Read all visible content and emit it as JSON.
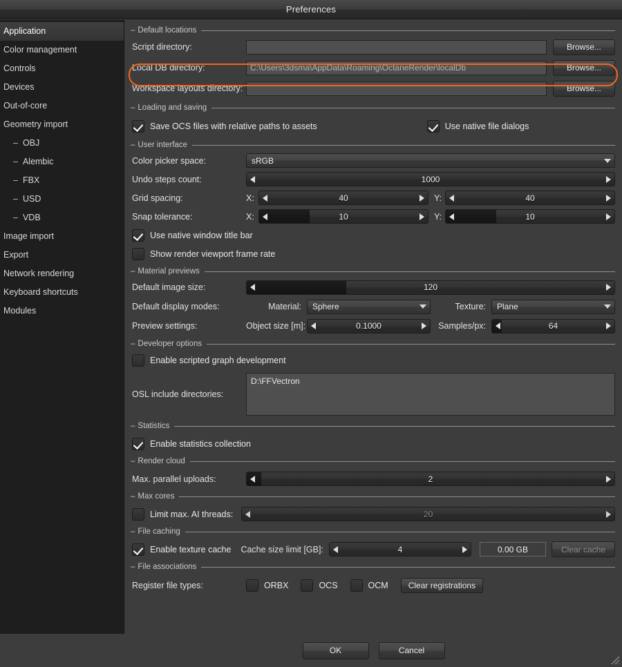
{
  "window": {
    "title": "Preferences"
  },
  "sidebar": {
    "items": [
      {
        "label": "Application",
        "selected": true,
        "sub": false
      },
      {
        "label": "Color management",
        "selected": false,
        "sub": false
      },
      {
        "label": "Controls",
        "selected": false,
        "sub": false
      },
      {
        "label": "Devices",
        "selected": false,
        "sub": false
      },
      {
        "label": "Out-of-core",
        "selected": false,
        "sub": false
      },
      {
        "label": "Geometry import",
        "selected": false,
        "sub": false
      },
      {
        "label": "OBJ",
        "selected": false,
        "sub": true
      },
      {
        "label": "Alembic",
        "selected": false,
        "sub": true
      },
      {
        "label": "FBX",
        "selected": false,
        "sub": true
      },
      {
        "label": "USD",
        "selected": false,
        "sub": true
      },
      {
        "label": "VDB",
        "selected": false,
        "sub": true
      },
      {
        "label": "Image import",
        "selected": false,
        "sub": false
      },
      {
        "label": "Export",
        "selected": false,
        "sub": false
      },
      {
        "label": "Network rendering",
        "selected": false,
        "sub": false
      },
      {
        "label": "Keyboard shortcuts",
        "selected": false,
        "sub": false
      },
      {
        "label": "Modules",
        "selected": false,
        "sub": false
      }
    ]
  },
  "groups": {
    "default_locations": "Default locations",
    "loading_and_saving": "Loading and saving",
    "user_interface": "User interface",
    "material_previews": "Material previews",
    "developer_options": "Developer options",
    "statistics": "Statistics",
    "render_cloud": "Render cloud",
    "max_cores": "Max cores",
    "file_caching": "File caching",
    "file_associations": "File associations"
  },
  "default_locations": {
    "script_dir_label": "Script directory:",
    "script_dir_value": "",
    "local_db_label": "Local DB directory:",
    "local_db_value": "C:\\Users\\3dsma\\AppData\\Roaming\\OctaneRender\\localDb",
    "workspace_label": "Workspace layouts directory:",
    "workspace_value": "",
    "browse_label": "Browse...",
    "highlight_color": "#f26722"
  },
  "loading_and_saving": {
    "save_ocs_label": "Save OCS files with relative paths to assets",
    "save_ocs_checked": true,
    "native_dialogs_label": "Use native file dialogs",
    "native_dialogs_checked": true
  },
  "user_interface": {
    "color_picker_label": "Color picker space:",
    "color_picker_value": "sRGB",
    "undo_label": "Undo steps count:",
    "undo_value": "1000",
    "undo_fill_pct": 0,
    "grid_label": "Grid spacing:",
    "grid_x_prefix": "X:",
    "grid_x_value": "40",
    "grid_x_fill_pct": 0,
    "grid_y_prefix": "Y:",
    "grid_y_value": "40",
    "grid_y_fill_pct": 0,
    "snap_label": "Snap tolerance:",
    "snap_x_prefix": "X:",
    "snap_x_value": "10",
    "snap_x_fill_pct": 30,
    "snap_y_prefix": "Y:",
    "snap_y_value": "10",
    "snap_y_fill_pct": 30,
    "title_bar_label": "Use native window title bar",
    "title_bar_checked": true,
    "frame_rate_label": "Show render viewport frame rate",
    "frame_rate_checked": false
  },
  "material_previews": {
    "image_size_label": "Default image size:",
    "image_size_value": "120",
    "image_size_fill_pct": 27,
    "display_modes_label": "Default display modes:",
    "material_prefix": "Material:",
    "material_value": "Sphere",
    "texture_prefix": "Texture:",
    "texture_value": "Plane",
    "preview_settings_label": "Preview settings:",
    "object_size_prefix": "Object size [m]:",
    "object_size_value": "0.1000",
    "object_size_fill_pct": 0,
    "samples_prefix": "Samples/px:",
    "samples_value": "64",
    "samples_fill_pct": 8
  },
  "developer_options": {
    "scripted_graph_label": "Enable scripted graph development",
    "scripted_graph_checked": false,
    "osl_label": "OSL include directories:",
    "osl_value": "D:\\FFVectron"
  },
  "statistics": {
    "collection_label": "Enable statistics collection",
    "collection_checked": true
  },
  "render_cloud": {
    "uploads_label": "Max. parallel uploads:",
    "uploads_value": "2",
    "uploads_fill_pct": 4
  },
  "max_cores": {
    "limit_threads_label": "Limit max. AI threads:",
    "limit_threads_checked": false,
    "threads_value": "20",
    "threads_fill_pct": 0,
    "threads_disabled": true
  },
  "file_caching": {
    "texture_cache_label": "Enable texture cache",
    "texture_cache_checked": true,
    "cache_size_label": "Cache size limit [GB]:",
    "cache_size_value": "4",
    "cache_size_fill_pct": 0,
    "cache_used_value": "0.00 GB",
    "clear_cache_label": "Clear cache",
    "clear_cache_disabled": true
  },
  "file_associations": {
    "register_label": "Register file types:",
    "orbx_label": "ORBX",
    "orbx_checked": false,
    "ocs_label": "OCS",
    "ocs_checked": false,
    "ocm_label": "OCM",
    "ocm_checked": false,
    "clear_registrations_label": "Clear registrations"
  },
  "footer": {
    "ok_label": "OK",
    "cancel_label": "Cancel"
  }
}
